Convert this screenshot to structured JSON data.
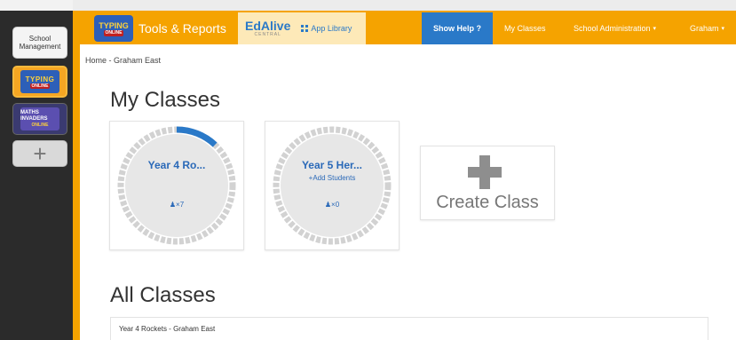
{
  "rail": {
    "school_label_1": "School",
    "school_label_2": "Management",
    "typing_logo_1": "TYPING",
    "typing_logo_2": "ONLINE",
    "maths_logo_1": "MATHS INVADERS",
    "maths_logo_2": "ONLINE",
    "add_label": "+"
  },
  "nav": {
    "brand_logo_1": "TYPING",
    "brand_logo_2": "ONLINE",
    "brand_label": "Tools & Reports",
    "edalive_logo": "EdAlive",
    "edalive_sub": "CENTRAL",
    "app_library": "App Library",
    "help": "Show Help ?",
    "my_classes": "My Classes",
    "school_admin": "School Administration",
    "user": "Graham",
    "caret": "▾"
  },
  "breadcrumb": "Home - Graham East",
  "my_classes_heading": "My Classes",
  "classes": [
    {
      "name": "Year 4 Ro...",
      "students": "7",
      "progress": 0.12
    },
    {
      "name": "Year 5 Her...",
      "add_students": "+Add Students",
      "students": "0",
      "progress": 0
    }
  ],
  "create_class": "Create Class",
  "all_classes_heading": "All Classes",
  "all_classes_rows": [
    "Year 4 Rockets - Graham East"
  ],
  "colors": {
    "brand_orange": "#f5a300",
    "accent_blue": "#2a79c8",
    "ring_grey": "#d7d7d7"
  }
}
